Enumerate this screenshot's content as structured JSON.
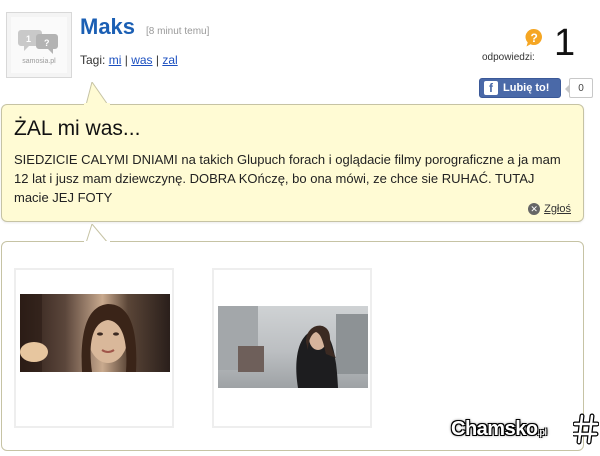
{
  "avatar": {
    "label": "samosia.pl"
  },
  "post": {
    "author": "Maks",
    "time": "[8 minut temu]",
    "tags_label": "Tagi:",
    "tags": [
      "mi",
      "was",
      "zal"
    ],
    "tag_separator": "|",
    "title": "ŻAL mi was...",
    "body": "SIEDZICIE CALYMI DNIAMI na takich Glupuch forach i oglądacie filmy porograficzne a ja mam 12 lat i jusz mam dziewczynę. DOBRA KOńczę, bo ona mówi, ze chce sie RUHAĆ. TUTAJ macie JEJ FOTY",
    "report_label": "Zgłoś"
  },
  "answers": {
    "label": "odpowiedzi:",
    "count": "1"
  },
  "like": {
    "label": "Lubię to!",
    "count": "0",
    "fb_letter": "f"
  },
  "gallery": {
    "photos": [
      {
        "name": "photo-1",
        "desc_icon": "photo"
      },
      {
        "name": "photo-2",
        "desc_icon": "photo"
      }
    ]
  },
  "watermark": {
    "text": "Chamsko",
    "suffix": ".pl"
  },
  "colors": {
    "author": "#1b5fb4",
    "bubble_bg": "#fffbd4",
    "question_icon": "#f5a623",
    "facebook": "#4a69a8"
  }
}
